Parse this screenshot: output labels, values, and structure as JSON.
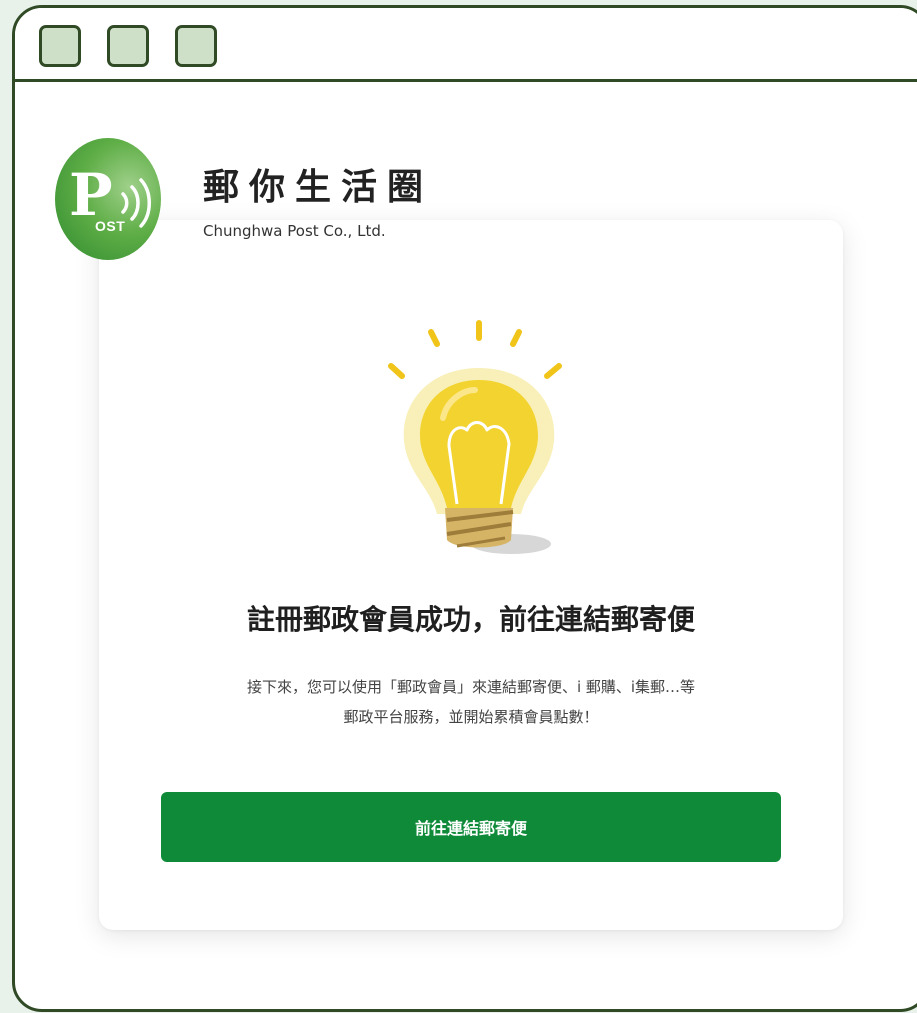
{
  "brand": {
    "title": "郵你生活圈",
    "subtitle": "Chunghwa Post Co., Ltd.",
    "logo_letter": "P",
    "logo_text": "OST"
  },
  "colors": {
    "frame": "#2f4a25",
    "window_button_fill": "#cfe0c9",
    "primary": "#0f8a39",
    "logo_green": "#5fae47",
    "bulb_yellow": "#f3d330"
  },
  "card": {
    "heading": "註冊郵政會員成功，前往連結郵寄便",
    "description_line1": "接下來，您可以使用「郵政會員」來連結郵寄便、i 郵購、i集郵…等",
    "description_line2": "郵政平台服務，並開始累積會員點數！",
    "button_label": "前往連結郵寄便"
  },
  "icons": {
    "illustration": "lightbulb-icon",
    "logo": "post-logo-icon"
  }
}
